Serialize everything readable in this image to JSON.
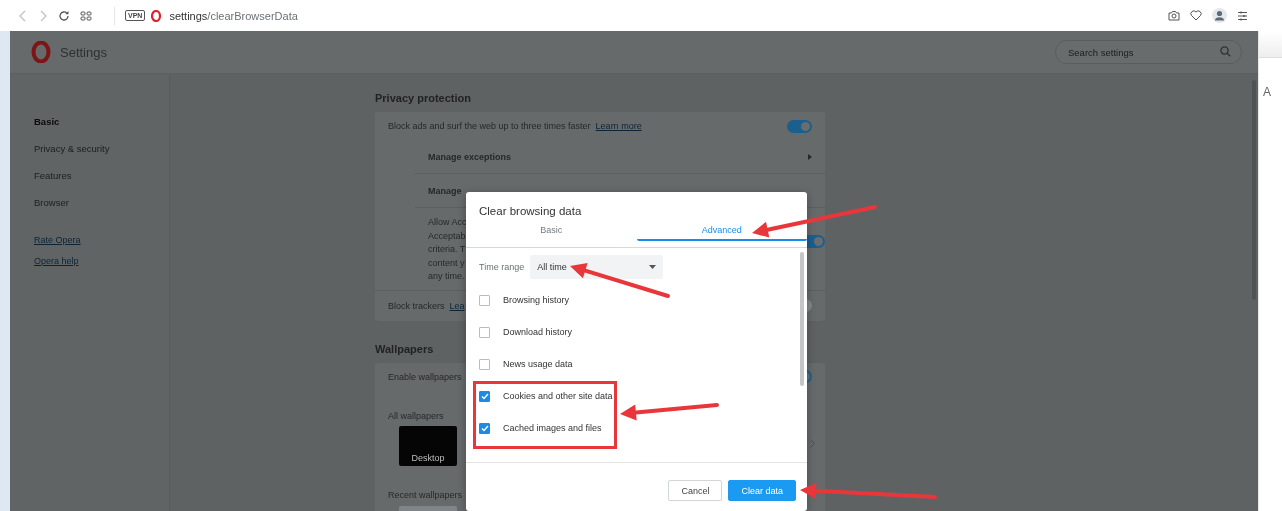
{
  "toolbar": {
    "address": {
      "host": "settings",
      "path": "/clearBrowserData"
    },
    "vpn_badge": "VPN"
  },
  "header": {
    "title": "Settings",
    "search": {
      "placeholder": "Search settings"
    }
  },
  "sidebar": {
    "items": [
      {
        "label": "Basic",
        "selected": true
      },
      {
        "label": "Privacy & security",
        "selected": false
      },
      {
        "label": "Features",
        "selected": false
      },
      {
        "label": "Browser",
        "selected": false
      }
    ],
    "links": [
      "Rate Opera",
      "Opera help"
    ]
  },
  "sections": [
    {
      "heading": "Privacy protection",
      "block_ads": {
        "label": "Block ads and surf the web up to three times faster",
        "link": "Learn more",
        "on": true
      },
      "manage_exceptions": "Manage exceptions",
      "manage_cut": "Manage",
      "description_lines": [
        "Allow Acc",
        "Acceptab",
        "criteria. T",
        "content y",
        "any time."
      ],
      "description_toggle_on": true,
      "block_trackers": {
        "label": "Block trackers",
        "link": "Lea",
        "on": false
      }
    },
    {
      "heading": "Wallpapers",
      "enable": {
        "label": "Enable wallpapers",
        "on": true
      },
      "all_label": "All wallpapers",
      "thumbnail_label": "Desktop",
      "recent_label": "Recent wallpapers"
    }
  ],
  "side_text": "A",
  "dialog": {
    "title": "Clear browsing data",
    "tabs": [
      {
        "label": "Basic",
        "selected": false
      },
      {
        "label": "Advanced",
        "selected": true
      }
    ],
    "time_range": {
      "label": "Time range",
      "value": "All time"
    },
    "options": [
      {
        "label": "Browsing history",
        "checked": false
      },
      {
        "label": "Download history",
        "checked": false
      },
      {
        "label": "News usage data",
        "checked": false
      },
      {
        "label": "Cookies and other site data",
        "checked": true
      },
      {
        "label": "Cached images and files",
        "checked": true
      }
    ],
    "buttons": [
      {
        "label": "Cancel",
        "kind": "secondary"
      },
      {
        "label": "Clear data",
        "kind": "primary"
      }
    ]
  }
}
